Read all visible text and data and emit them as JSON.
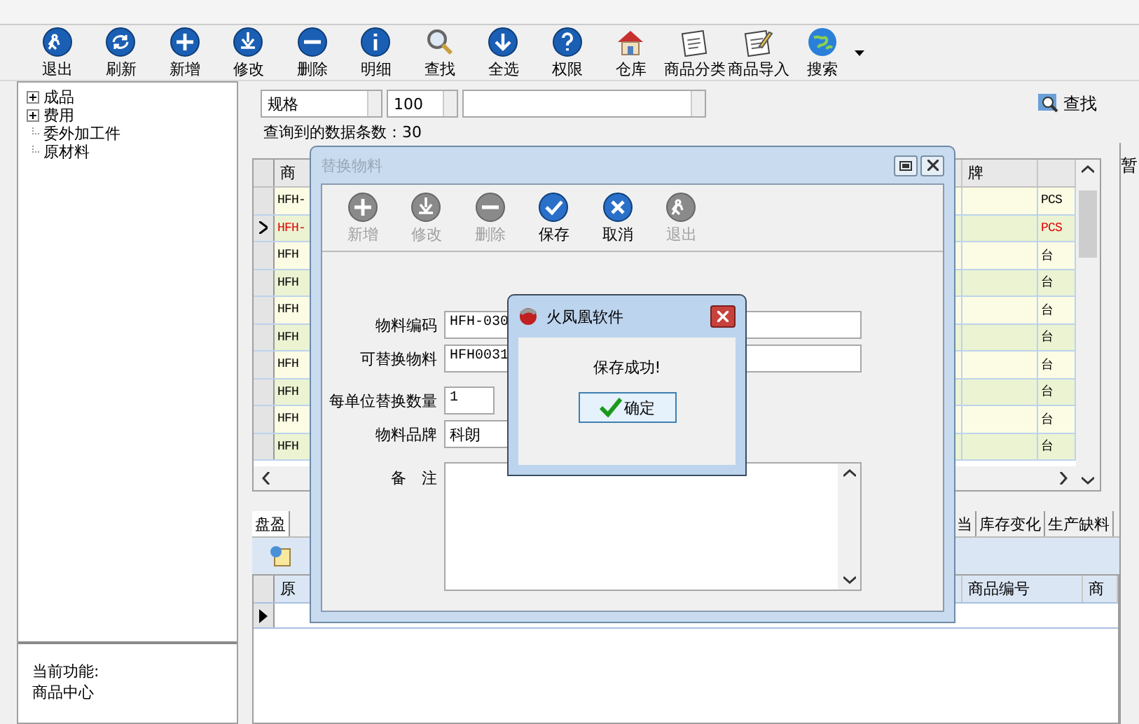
{
  "toolbar": {
    "buttons": [
      {
        "label": "退出"
      },
      {
        "label": "刷新"
      },
      {
        "label": "新增"
      },
      {
        "label": "修改"
      },
      {
        "label": "删除"
      },
      {
        "label": "明细"
      },
      {
        "label": "查找"
      },
      {
        "label": "全选"
      },
      {
        "label": "权限"
      },
      {
        "label": "仓库"
      },
      {
        "label": "商品分类"
      },
      {
        "label": "商品导入"
      },
      {
        "label": "搜索"
      }
    ]
  },
  "tree": {
    "items": [
      {
        "label": "成品",
        "kind": "folder",
        "expanded": false
      },
      {
        "label": "费用",
        "kind": "folder",
        "expanded": false
      },
      {
        "label": "委外加工件",
        "kind": "leaf"
      },
      {
        "label": "原材料",
        "kind": "leaf"
      }
    ]
  },
  "info": {
    "label": "当前功能:",
    "value": "商品中心"
  },
  "filter": {
    "field": "规格",
    "limit": "100",
    "search_button": "查找"
  },
  "result_count": "查询到的数据条数：30",
  "grid": {
    "columns": {
      "column_1": "商",
      "column_2": "牌"
    },
    "rows": [
      {
        "code": "HFH-",
        "unit": "PCS",
        "selected": false
      },
      {
        "code": "HFH-",
        "unit": "PCS",
        "selected": true
      },
      {
        "code": "HFH",
        "unit": "台",
        "selected": false
      },
      {
        "code": "HFH",
        "unit": "台",
        "selected": false
      },
      {
        "code": "HFH",
        "unit": "台",
        "selected": false
      },
      {
        "code": "HFH",
        "unit": "台",
        "selected": false
      },
      {
        "code": "HFH",
        "unit": "台",
        "selected": false
      },
      {
        "code": "HFH",
        "unit": "台",
        "selected": false
      },
      {
        "code": "HFH",
        "unit": "台",
        "selected": false
      },
      {
        "code": "HFH",
        "unit": "台",
        "selected": false
      }
    ]
  },
  "bottom_tabs": [
    {
      "label": "盘盈",
      "selected": true
    },
    {
      "label": "当",
      "selected": false
    },
    {
      "label": "库存变化",
      "selected": false
    },
    {
      "label": "生产缺料",
      "selected": false
    }
  ],
  "lower_grid": {
    "columns": [
      "原",
      "商品编号",
      "商"
    ]
  },
  "side_panel": {
    "title": "暂"
  },
  "dialog": {
    "title": "替换物料",
    "active": false,
    "buttons": [
      {
        "label": "新增",
        "disabled": true
      },
      {
        "label": "修改",
        "disabled": true
      },
      {
        "label": "删除",
        "disabled": true
      },
      {
        "label": "保存",
        "disabled": false
      },
      {
        "label": "取消",
        "disabled": false
      },
      {
        "label": "退出",
        "disabled": true
      }
    ],
    "fields": [
      {
        "label": "物料编码",
        "value": "HFH-030",
        "kind": "wide"
      },
      {
        "label": "可替换物料",
        "value": "HFH0031",
        "kind": "wide"
      },
      {
        "label": "每单位替换数量",
        "value": "1",
        "kind": "short"
      },
      {
        "label": "物料品牌",
        "value": "科朗",
        "kind": "medium"
      },
      {
        "label": "备　注",
        "kind": "memo"
      }
    ]
  },
  "message_box": {
    "title": "火凤凰软件",
    "message": "保存成功!",
    "button": "确定"
  }
}
